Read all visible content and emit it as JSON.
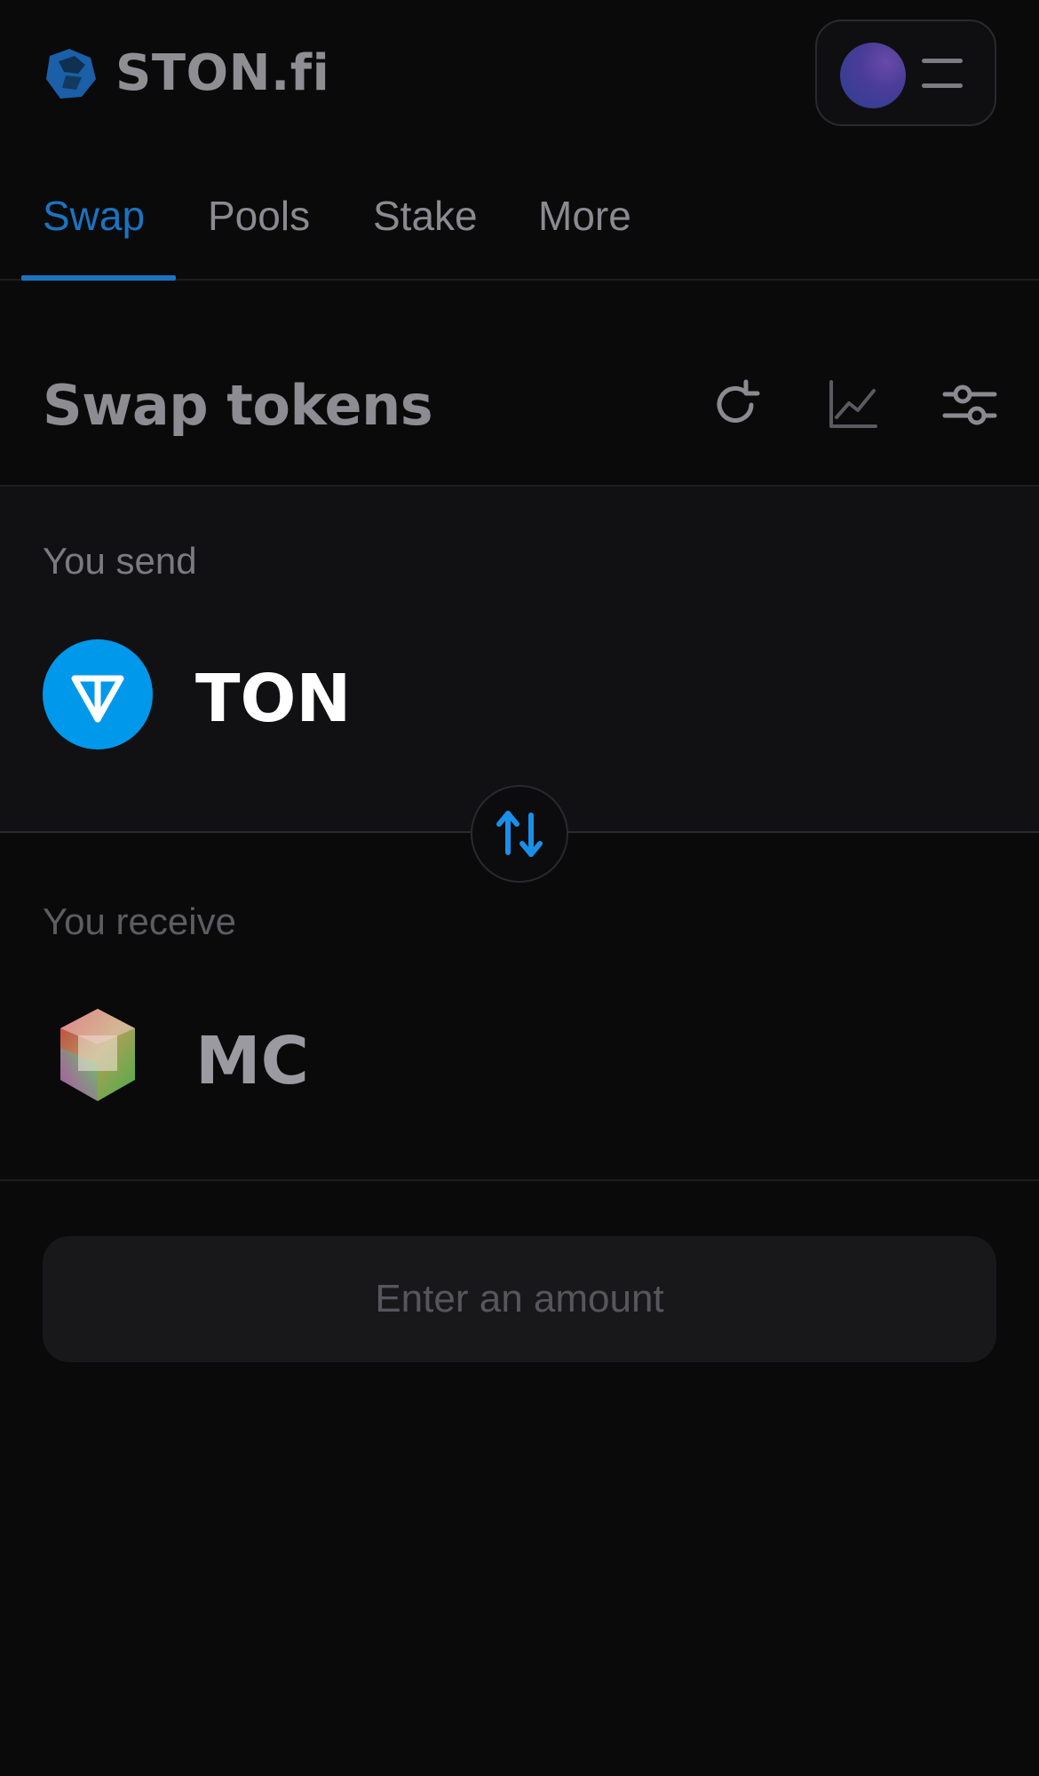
{
  "brand": {
    "name": "STON.fi",
    "accent": "#1a74c2"
  },
  "nav": {
    "tabs": [
      {
        "label": "Swap",
        "active": true
      },
      {
        "label": "Pools",
        "active": false
      },
      {
        "label": "Stake",
        "active": false
      },
      {
        "label": "More",
        "active": false
      }
    ]
  },
  "swap": {
    "title": "Swap tokens",
    "actions": [
      "refresh-icon",
      "chart-icon",
      "settings-sliders-icon"
    ],
    "send": {
      "label": "You send",
      "token": "TON",
      "token_color": "#0098ea"
    },
    "receive": {
      "label": "You receive",
      "token": "MC"
    },
    "switch_icon": "swap-arrows-icon",
    "cta_label": "Enter an amount"
  }
}
